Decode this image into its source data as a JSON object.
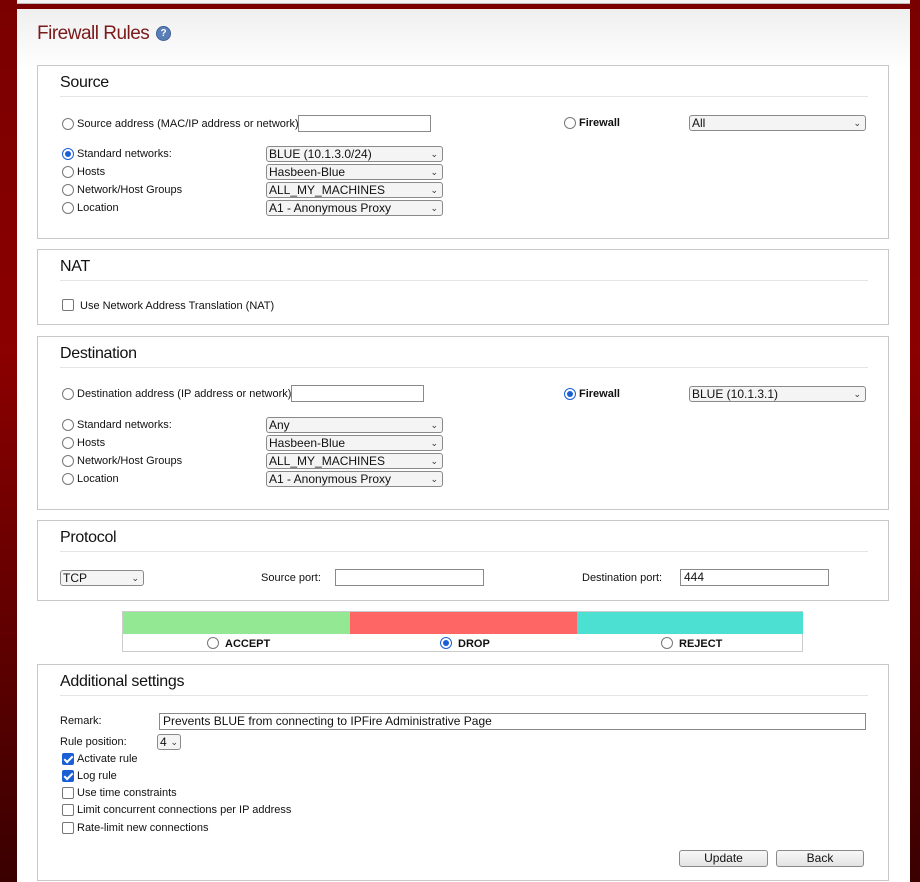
{
  "page": {
    "title": "Firewall Rules",
    "help_icon": "help-icon",
    "help_glyph": "?"
  },
  "source": {
    "heading": "Source",
    "address_label": "Source address (MAC/IP address or network):",
    "address_value": "",
    "firewall_label": "Firewall",
    "firewall_select": "All",
    "standard_label": "Standard networks:",
    "standard_select": "BLUE (10.1.3.0/24)",
    "hosts_label": "Hosts",
    "hosts_select": "Hasbeen-Blue",
    "groups_label": "Network/Host Groups",
    "groups_select": "ALL_MY_MACHINES",
    "location_label": "Location",
    "location_select": "A1 - Anonymous Proxy",
    "selected": "standard"
  },
  "nat": {
    "heading": "NAT",
    "checkbox_label": "Use Network Address Translation (NAT)",
    "checked": false
  },
  "destination": {
    "heading": "Destination",
    "address_label": "Destination address (IP address or network):",
    "address_value": "",
    "firewall_label": "Firewall",
    "firewall_select": "BLUE (10.1.3.1)",
    "standard_label": "Standard networks:",
    "standard_select": "Any",
    "hosts_label": "Hosts",
    "hosts_select": "Hasbeen-Blue",
    "groups_label": "Network/Host Groups",
    "groups_select": "ALL_MY_MACHINES",
    "location_label": "Location",
    "location_select": "A1 - Anonymous Proxy",
    "selected": "firewall"
  },
  "protocol": {
    "heading": "Protocol",
    "protocol_select": "TCP",
    "source_port_label": "Source port:",
    "source_port_value": "",
    "dest_port_label": "Destination port:",
    "dest_port_value": "444"
  },
  "action": {
    "accept_label": "ACCEPT",
    "drop_label": "DROP",
    "reject_label": "REJECT",
    "selected": "DROP",
    "accept_color": "#93e993",
    "drop_color": "#fe6565",
    "reject_color": "#4ce0d2"
  },
  "additional": {
    "heading": "Additional settings",
    "remark_label": "Remark:",
    "remark_value": "Prevents BLUE from connecting to IPFire Administrative Page",
    "position_label": "Rule position:",
    "position_value": "4",
    "activate_label": "Activate rule",
    "log_label": "Log rule",
    "time_label": "Use time constraints",
    "limit_label": "Limit concurrent connections per IP address",
    "rate_label": "Rate-limit new connections",
    "activate_checked": true,
    "log_checked": true,
    "time_checked": false,
    "limit_checked": false,
    "rate_checked": false
  },
  "buttons": {
    "update_label": "Update",
    "back_label": "Back"
  },
  "glyphs": {
    "chevron": "⌄"
  }
}
